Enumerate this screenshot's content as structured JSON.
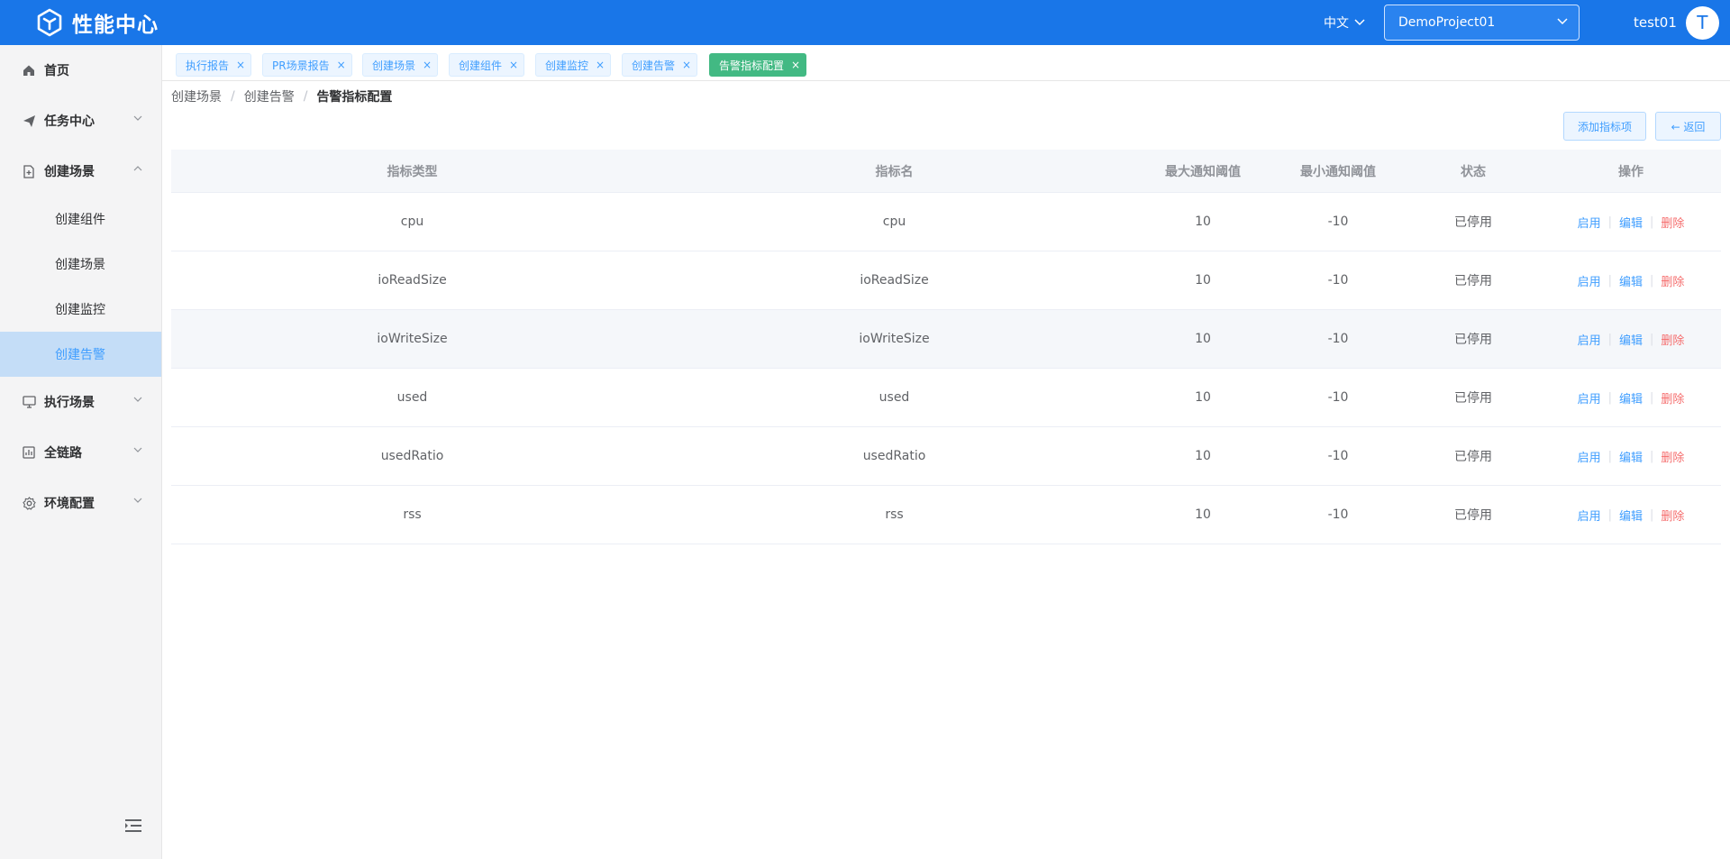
{
  "header": {
    "app_title": "性能中心",
    "language": "中文",
    "project": "DemoProject01",
    "username": "test01",
    "avatar_letter": "T",
    "brand_color": "#1976e8"
  },
  "sidebar": {
    "items": [
      {
        "label": "首页",
        "icon": "home-icon"
      },
      {
        "label": "任务中心",
        "icon": "send-icon"
      },
      {
        "label": "创建场景",
        "icon": "file-add-icon"
      },
      {
        "label": "执行场景",
        "icon": "monitor-icon"
      },
      {
        "label": "全链路",
        "icon": "chart-icon"
      },
      {
        "label": "环境配置",
        "icon": "gear-icon"
      }
    ],
    "sub_items": [
      "创建组件",
      "创建场景",
      "创建监控",
      "创建告警"
    ],
    "active_sub": "创建告警"
  },
  "tags": [
    {
      "label": "执行报告"
    },
    {
      "label": "PR场景报告"
    },
    {
      "label": "创建场景"
    },
    {
      "label": "创建组件"
    },
    {
      "label": "创建监控"
    },
    {
      "label": "创建告警"
    },
    {
      "label": "告警指标配置",
      "active": true
    }
  ],
  "breadcrumb": [
    "创建场景",
    "创建告警",
    "告警指标配置"
  ],
  "actions": {
    "add_label": "添加指标项",
    "back_label": "← 返回"
  },
  "table": {
    "headers": [
      "指标类型",
      "指标名",
      "最大通知阈值",
      "最小通知阈值",
      "状态",
      "操作"
    ],
    "rows": [
      {
        "type": "cpu",
        "name": "cpu",
        "max": "10",
        "min": "-10",
        "status": "已停用"
      },
      {
        "type": "ioReadSize",
        "name": "ioReadSize",
        "max": "10",
        "min": "-10",
        "status": "已停用"
      },
      {
        "type": "ioWriteSize",
        "name": "ioWriteSize",
        "max": "10",
        "min": "-10",
        "status": "已停用"
      },
      {
        "type": "used",
        "name": "used",
        "max": "10",
        "min": "-10",
        "status": "已停用"
      },
      {
        "type": "usedRatio",
        "name": "usedRatio",
        "max": "10",
        "min": "-10",
        "status": "已停用"
      },
      {
        "type": "rss",
        "name": "rss",
        "max": "10",
        "min": "-10",
        "status": "已停用"
      }
    ],
    "ops": {
      "enable": "启用",
      "edit": "编辑",
      "delete": "删除"
    }
  }
}
